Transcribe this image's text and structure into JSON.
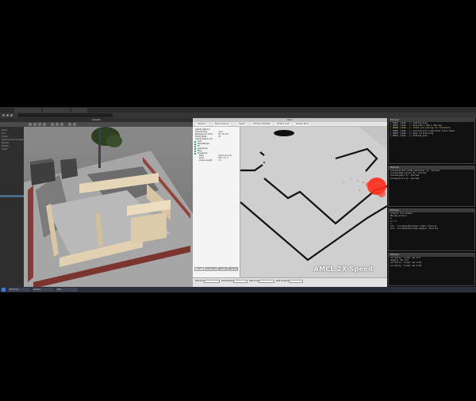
{
  "browser": {
    "tabs": [
      "",
      "",
      ""
    ],
    "url": ""
  },
  "gazebo": {
    "title": "Gazebo",
    "tree": [
      "World",
      "GUI",
      "Scene",
      "Spherical Coordinates",
      "Physics",
      "Models",
      "Lights"
    ]
  },
  "rviz": {
    "title": "RViz",
    "tools": [
      "Interact",
      "Move Camera",
      "Select",
      "2D Pose Estimate",
      "2D Nav Goal",
      "Publish Point"
    ],
    "displays": [
      {
        "label": "Global Options",
        "value": ""
      },
      {
        "label": "Fixed Frame",
        "value": "map"
      },
      {
        "label": "Background Color",
        "value": "48; 48; 48"
      },
      {
        "label": "Frame Rate",
        "value": "30"
      },
      {
        "label": "Global Status: Ok",
        "value": ""
      },
      {
        "label": "Grid",
        "value": ""
      },
      {
        "label": "RobotModel",
        "value": ""
      },
      {
        "label": "TF",
        "value": ""
      },
      {
        "label": "LaserScan",
        "value": ""
      },
      {
        "label": "Map",
        "value": ""
      },
      {
        "label": "PoseArray",
        "value": ""
      },
      {
        "label": "Topic",
        "value": "/particlecloud"
      },
      {
        "label": "Color",
        "value": "255; 25; 0"
      },
      {
        "label": "Arrow Length",
        "value": "0.3"
      }
    ],
    "buttons": [
      "Add",
      "Duplicate",
      "Remove",
      "Rename"
    ],
    "status": {
      "ros_time_label": "ROS Time:",
      "ros_elapsed_label": "ROS Elapsed:",
      "wall_time_label": "Wall Time:",
      "wall_elapsed_label": "Wall Elapsed:"
    },
    "overlay": "AMCL   2X Speed"
  },
  "terminals": [
    {
      "title": "Terminal",
      "lines": [
        "[ INFO] [1542...]: Setting pose",
        "[ INFO] [1542...]: Received a 384 X 384 map",
        "[ WARN] [1542...]: Timed out waiting for transform",
        "[ INFO] [1542...]: Initializing likelihood field model",
        "[ INFO] [1542...]: Done initializing",
        "[ INFO] [1542...]: Setting pose"
      ]
    },
    {
      "title": "Terminal",
      "lines": [
        "process[robot_state_publisher-1]: started",
        "process[map_server-2]: started",
        "process[amcl-3]: started",
        "process[rviz-4]: started"
      ]
    },
    {
      "title": "Terminal",
      "lines": [
        "Control Your Robot!",
        "Moving around:",
        "   w",
        "a  s  d",
        "   x",
        "w/x : increase/decrease linear velocity",
        "a/d : increase/decrease angular velocity"
      ]
    },
    {
      "title": "Terminal",
      "lines": [
        "currently:  linear vel 0.0",
        "           angular vel 0.0",
        "currently:  linear vel 0.01",
        "currently:  linear vel 0.02"
      ]
    }
  ],
  "taskbar": {
    "tasks": [
      "Terminal",
      "Gazebo",
      "RViz"
    ],
    "clock": ""
  }
}
